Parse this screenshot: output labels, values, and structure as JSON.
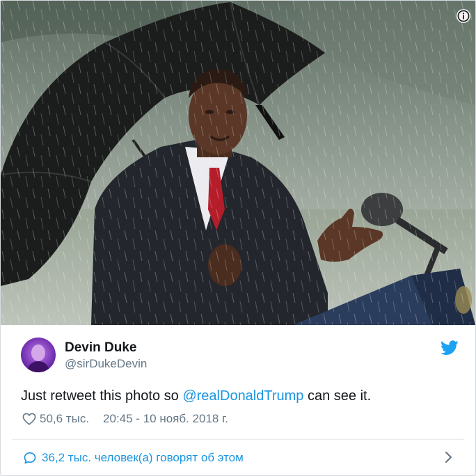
{
  "tweet": {
    "author": {
      "display_name": "Devin Duke",
      "handle": "@sirDukeDevin"
    },
    "text_before": "Just retweet this photo so ",
    "mention": "@realDonaldTrump",
    "text_after": " can see it.",
    "likes": "50,6 тыс.",
    "timestamp": "20:45 - 10 нояб. 2018 г.",
    "conversation": "36,2 тыс. человек(а) говорят об этом"
  },
  "icons": {
    "info": "info-icon",
    "bird": "twitter-bird-icon",
    "heart": "heart-icon",
    "bubble": "speech-bubble-icon",
    "chevron": "chevron-right-icon"
  },
  "colors": {
    "accent": "#1b95e0",
    "bird": "#1da1f2",
    "text": "#14171a",
    "muted": "#657786"
  }
}
